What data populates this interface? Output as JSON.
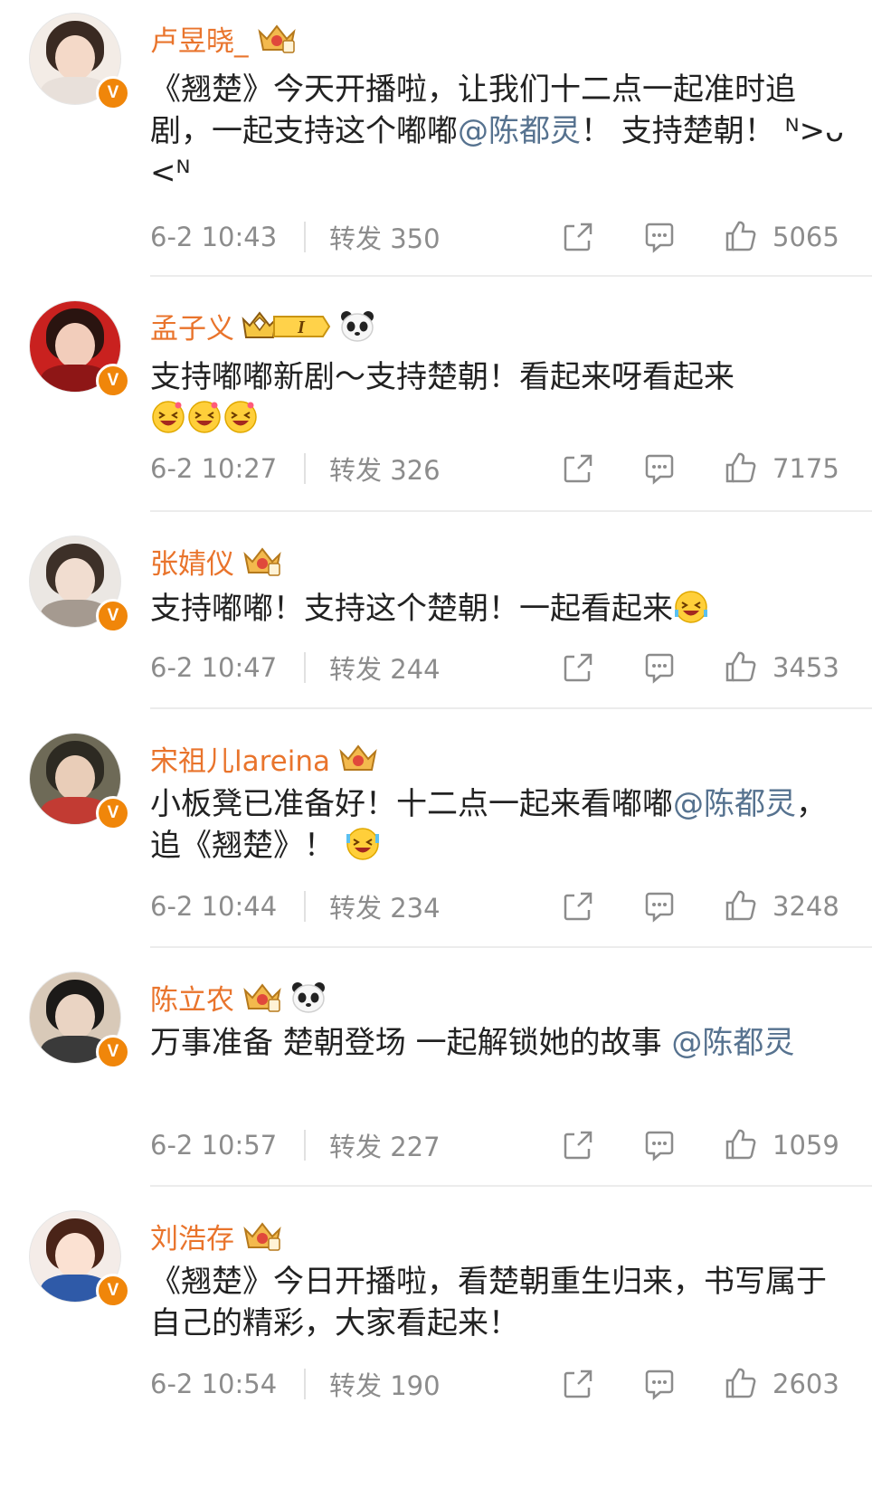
{
  "comments": [
    {
      "name": "卢昱晓_",
      "text_parts": [
        {
          "t": "《翘楚》今天开播啦，让我们十二点一起准时追剧，一起支持这个嘟嘟"
        },
        {
          "t": "@陈都灵",
          "mention": true
        },
        {
          "t": "！ 支持楚朝！ ᴺ>ᴗ<ᴺ"
        }
      ],
      "time": "6-2 10:43",
      "repost": "转发 350",
      "likes": "5065"
    },
    {
      "name": "孟子义",
      "text_parts": [
        {
          "t": "支持嘟嘟新剧～支持楚朝！看起来呀看起来"
        }
      ],
      "time": "6-2 10:27",
      "repost": "转发 326",
      "likes": "7175"
    },
    {
      "name": "张婧仪",
      "text_parts": [
        {
          "t": "支持嘟嘟！支持这个楚朝！一起看起来"
        }
      ],
      "time": "6-2 10:47",
      "repost": "转发 244",
      "likes": "3453"
    },
    {
      "name": "宋祖儿lareina",
      "text_parts": [
        {
          "t": "小板凳已准备好！十二点一起来看嘟嘟"
        },
        {
          "t": "@陈都灵",
          "mention": true
        },
        {
          "t": "，追《翘楚》！ "
        }
      ],
      "time": "6-2 10:44",
      "repost": "转发 234",
      "likes": "3248"
    },
    {
      "name": "陈立农",
      "text_parts": [
        {
          "t": "万事准备 楚朝登场 一起解锁她的故事 "
        },
        {
          "t": "@陈都灵",
          "mention": true
        }
      ],
      "time": "6-2 10:57",
      "repost": "转发 227",
      "likes": "1059"
    },
    {
      "name": "刘浩存",
      "text_parts": [
        {
          "t": "《翘楚》今日开播啦，看楚朝重生归来，书写属于自己的精彩，大家看起来！"
        }
      ],
      "time": "6-2 10:54",
      "repost": "转发 190",
      "likes": "2603"
    }
  ],
  "badges": {
    "verified_mark": "V",
    "level_badge_text": "I"
  },
  "colors": {
    "name": "#e9742c",
    "mention": "#56728f",
    "meta": "#8c8c8c",
    "verified": "#f0860a"
  },
  "icons": [
    "share-icon",
    "comment-icon",
    "like-icon",
    "crown-icon",
    "panda-icon",
    "laughing-emoji-icon"
  ]
}
